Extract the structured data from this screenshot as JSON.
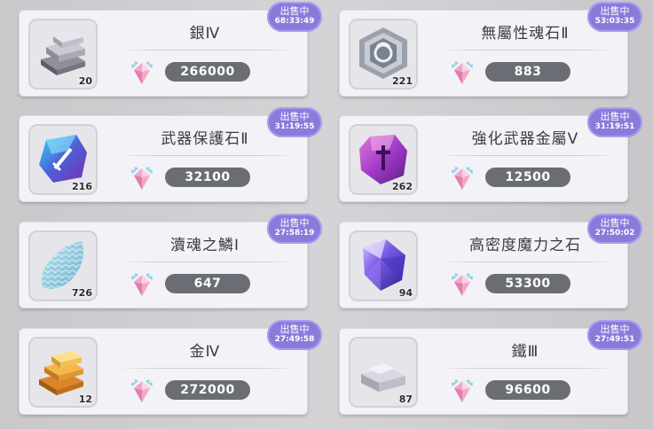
{
  "listings": [
    {
      "name": "銀Ⅳ",
      "quantity": "20",
      "price": "266000",
      "status": "出售中",
      "timer": "68:33:49",
      "icon": "silver-ingots-icon"
    },
    {
      "name": "無屬性魂石Ⅱ",
      "quantity": "221",
      "price": "883",
      "status": "出售中",
      "timer": "53:03:35",
      "icon": "soulstone-icon"
    },
    {
      "name": "武器保護石Ⅱ",
      "quantity": "216",
      "price": "32100",
      "status": "出售中",
      "timer": "31:19:55",
      "icon": "weapon-protect-stone-icon"
    },
    {
      "name": "強化武器金屬Ⅴ",
      "quantity": "262",
      "price": "12500",
      "status": "出售中",
      "timer": "31:19:51",
      "icon": "weapon-enhance-metal-icon"
    },
    {
      "name": "瀆魂之鱗Ⅰ",
      "quantity": "726",
      "price": "647",
      "status": "出售中",
      "timer": "27:58:19",
      "icon": "scale-icon"
    },
    {
      "name": "高密度魔力之石",
      "quantity": "94",
      "price": "53300",
      "status": "出售中",
      "timer": "27:50:02",
      "icon": "magic-crystal-icon"
    },
    {
      "name": "金Ⅳ",
      "quantity": "12",
      "price": "272000",
      "status": "出售中",
      "timer": "27:49:58",
      "icon": "gold-ingots-icon"
    },
    {
      "name": "鐵Ⅲ",
      "quantity": "87",
      "price": "96600",
      "status": "出售中",
      "timer": "27:49:51",
      "icon": "iron-ingot-icon"
    }
  ],
  "currency_icon": "winged-gem-icon",
  "colors": {
    "badge": "#8a7bdb",
    "price_pill": "#6b6d75",
    "card": "#f3f2f6"
  }
}
